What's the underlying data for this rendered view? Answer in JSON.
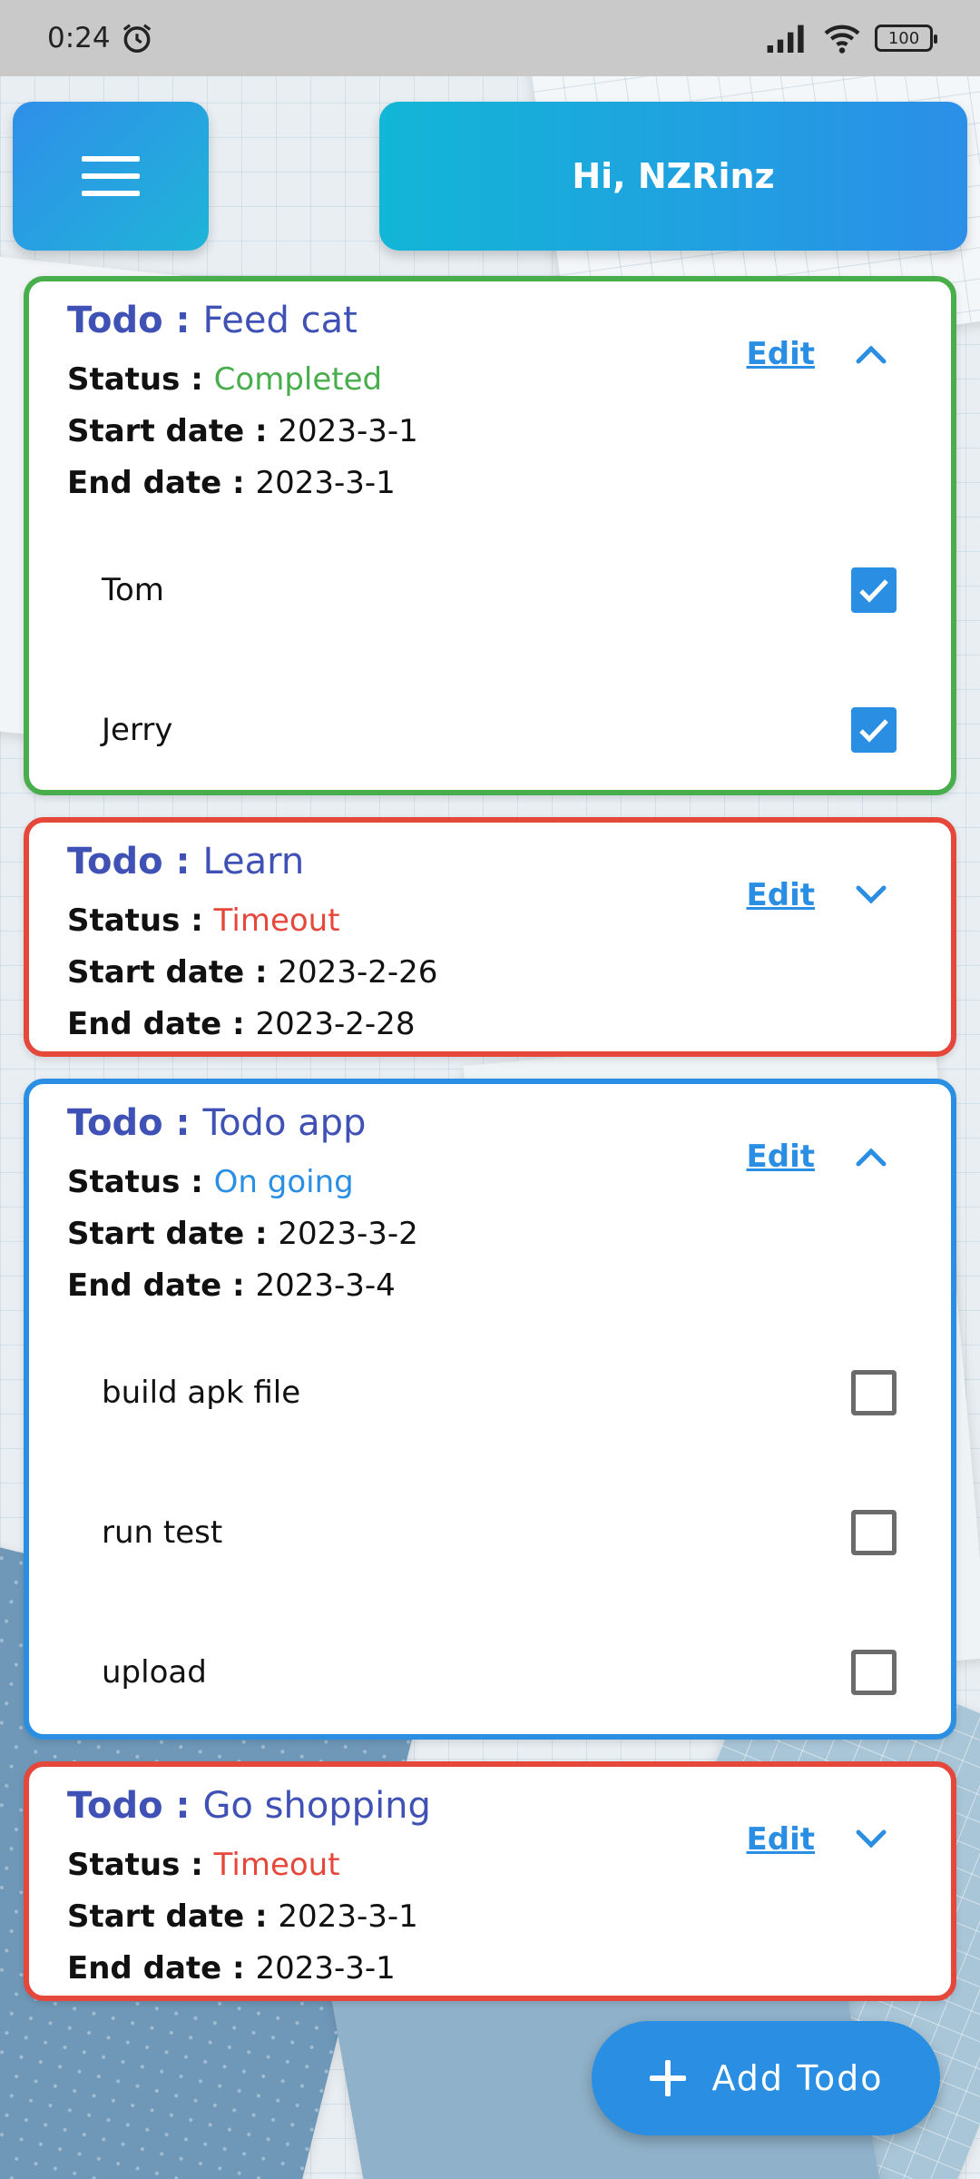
{
  "status_bar": {
    "time": "0:24",
    "battery": "100",
    "icons": [
      "alarm-icon",
      "signal-icon",
      "wifi-icon",
      "battery-icon"
    ]
  },
  "header": {
    "menu_icon": "hamburger-menu-icon",
    "greeting": "Hi, NZRinz"
  },
  "labels": {
    "todo": "Todo",
    "status": "Status",
    "start_date": "Start date",
    "end_date": "End date",
    "sep": " : ",
    "edit": "Edit"
  },
  "todos": [
    {
      "name": "Feed cat",
      "status": "Completed",
      "start": "2023-3-1",
      "end": "2023-3-1",
      "expanded": true,
      "tasks": [
        {
          "label": "Tom",
          "checked": true
        },
        {
          "label": "Jerry",
          "checked": true
        }
      ]
    },
    {
      "name": "Learn",
      "status": "Timeout",
      "start": "2023-2-26",
      "end": "2023-2-28",
      "expanded": false,
      "tasks": []
    },
    {
      "name": "Todo app",
      "status": "On going",
      "start": "2023-3-2",
      "end": "2023-3-4",
      "expanded": true,
      "tasks": [
        {
          "label": "build apk file",
          "checked": false
        },
        {
          "label": "run test",
          "checked": false
        },
        {
          "label": "upload",
          "checked": false
        }
      ]
    },
    {
      "name": "Go shopping",
      "status": "Timeout",
      "start": "2023-3-1",
      "end": "2023-3-1",
      "expanded": false,
      "tasks": []
    }
  ],
  "fab": {
    "label": "Add Todo",
    "icon": "plus-icon"
  },
  "colors": {
    "completed": "#47ae4b",
    "timeout": "#e5473b",
    "ongoing": "#2a8fe3",
    "title": "#3f51b5"
  }
}
